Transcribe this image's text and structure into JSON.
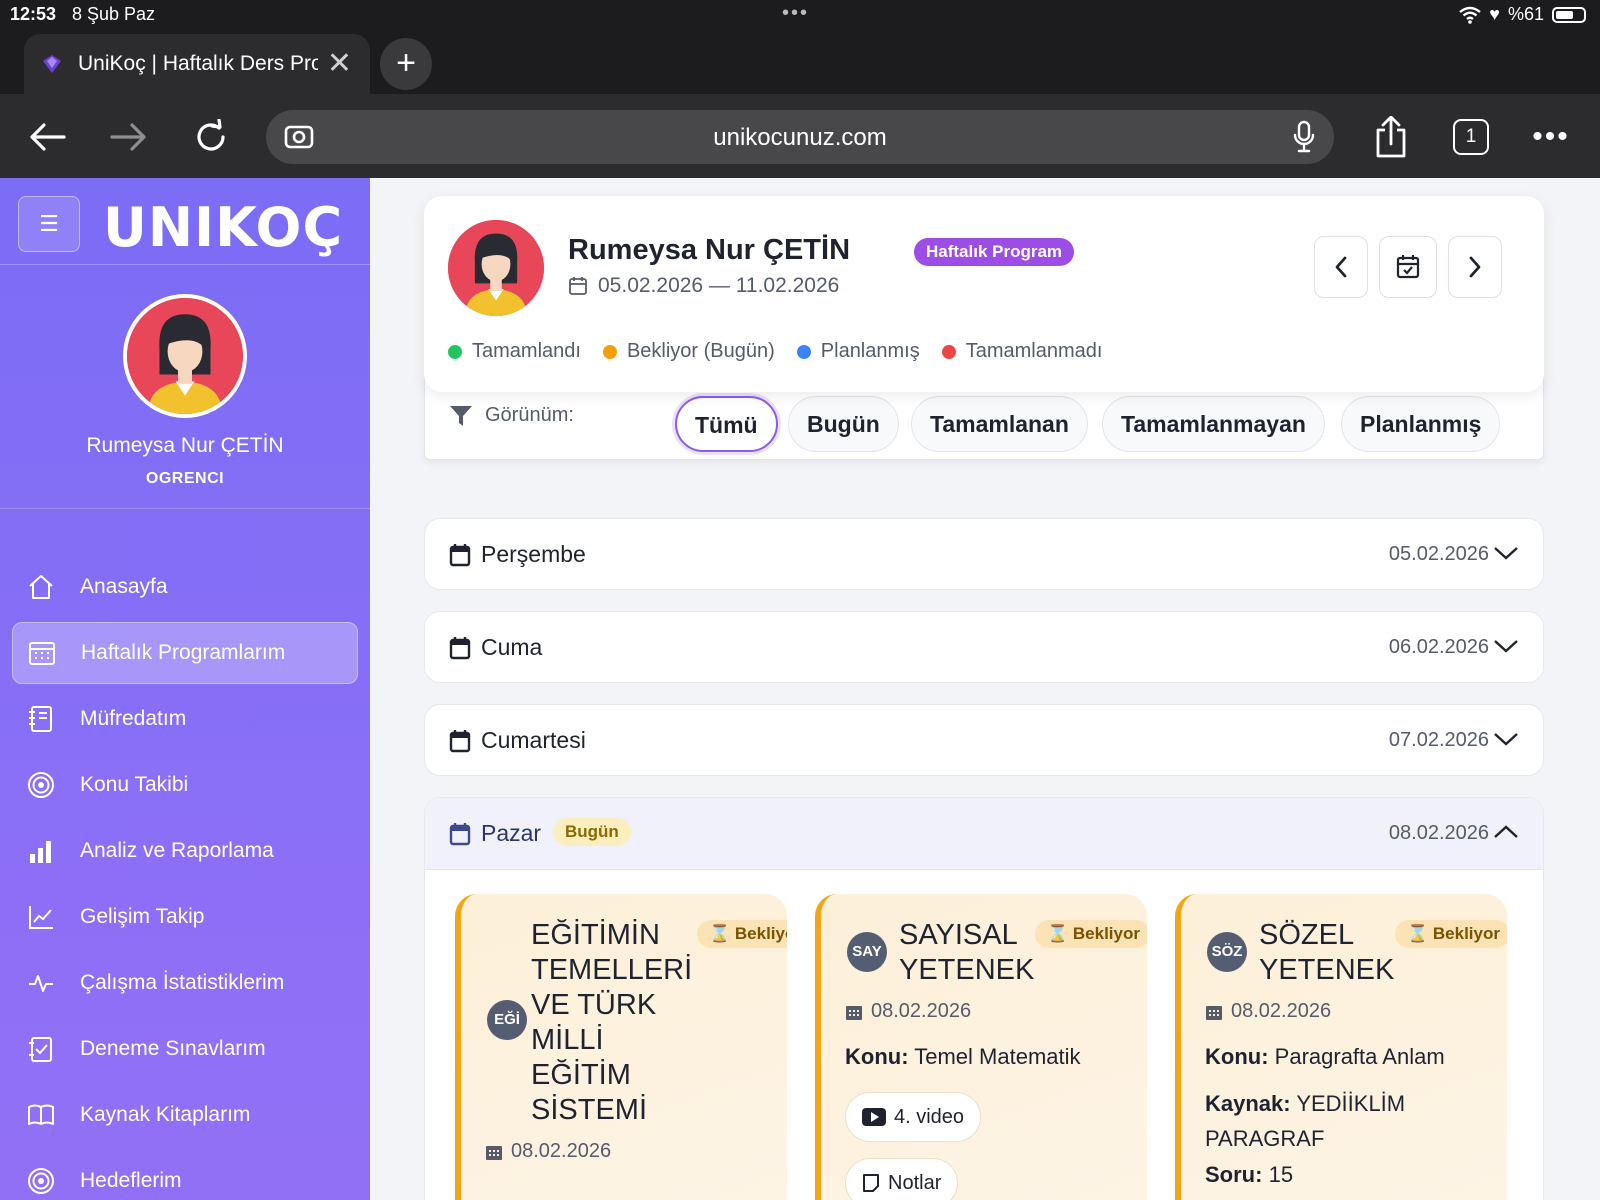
{
  "status_bar": {
    "time": "12:53",
    "date": "8 Şub Paz",
    "battery": "%61",
    "battery_level": 0.61
  },
  "browser": {
    "tab_title": "UniKoç | Haftalık Ders Programı",
    "url": "unikocunuz.com",
    "tab_count": "1"
  },
  "sidebar": {
    "logo": "UNIKOÇ",
    "user_name": "Rumeysa Nur ÇETİN",
    "user_role": "OGRENCI",
    "items": [
      {
        "label": "Anasayfa",
        "icon": "home-icon"
      },
      {
        "label": "Haftalık Programlarım",
        "icon": "calendar-grid-icon",
        "active": true
      },
      {
        "label": "Müfredatım",
        "icon": "notebook-icon"
      },
      {
        "label": "Konu Takibi",
        "icon": "target-icon"
      },
      {
        "label": "Analiz ve Raporlama",
        "icon": "bar-chart-icon"
      },
      {
        "label": "Gelişim Takip",
        "icon": "line-chart-icon"
      },
      {
        "label": "Çalışma İstatistiklerim",
        "icon": "pulse-icon"
      },
      {
        "label": "Deneme Sınavlarım",
        "icon": "checklist-icon"
      },
      {
        "label": "Kaynak Kitaplarım",
        "icon": "book-icon"
      },
      {
        "label": "Hedeflerim",
        "icon": "target-icon"
      }
    ]
  },
  "profile": {
    "name": "Rumeysa Nur ÇETİN",
    "badge": "Haftalık Program",
    "date_range": "05.02.2026 — 11.02.2026",
    "legend": [
      {
        "label": "Tamamlandı",
        "color": "#22c55e"
      },
      {
        "label": "Bekliyor (Bugün)",
        "color": "#f59e0b"
      },
      {
        "label": "Planlanmış",
        "color": "#3b82f6"
      },
      {
        "label": "Tamamlanmadı",
        "color": "#ef4444"
      }
    ]
  },
  "filter": {
    "label": "Görünüm:",
    "buttons": [
      "Tümü",
      "Bugün",
      "Tamamlanan",
      "Tamamlanmayan",
      "Planlanmış"
    ],
    "active": "Tümü"
  },
  "days": [
    {
      "name": "Perşembe",
      "date": "05.02.2026"
    },
    {
      "name": "Cuma",
      "date": "06.02.2026"
    },
    {
      "name": "Cumartesi",
      "date": "07.02.2026"
    },
    {
      "name": "Pazar",
      "date": "08.02.2026",
      "badge": "Bugün",
      "expanded": true
    }
  ],
  "tasks": [
    {
      "abbr": "EĞİ",
      "title": "EĞİTİMİN TEMELLERİ VE TÜRK MİLLİ EĞİTİM SİSTEMİ",
      "title_lines": [
        "EĞİTİMİN",
        "TEMELLERİ",
        "VE TÜRK",
        "MİLLİ",
        "EĞİTİM",
        "SİSTEMİ"
      ],
      "status": "Bekliyor",
      "date": "08.02.2026"
    },
    {
      "abbr": "SAY",
      "title": "SAYISAL YETENEK",
      "title_lines": [
        "SAYISAL",
        "YETENEK"
      ],
      "status": "Bekliyor",
      "date": "08.02.2026",
      "konu_label": "Konu:",
      "konu": "Temel Matematik",
      "chips": [
        "4. video",
        "Notlar"
      ]
    },
    {
      "abbr": "SÖZ",
      "title": "SÖZEL YETENEK",
      "title_lines": [
        "SÖZEL",
        "YETENEK"
      ],
      "status": "Bekliyor",
      "date": "08.02.2026",
      "konu_label": "Konu:",
      "konu": "Paragrafta Anlam",
      "kaynak_label": "Kaynak:",
      "kaynak_lines": [
        "YEDİİKLİM",
        "PARAGRAF"
      ],
      "soru_label": "Soru:",
      "soru": "15"
    }
  ],
  "colors": {
    "sidebar": "#7c6cf6",
    "accent": "#8a5cf5",
    "badge": "#9b4de6",
    "pending": "#f2a516"
  }
}
